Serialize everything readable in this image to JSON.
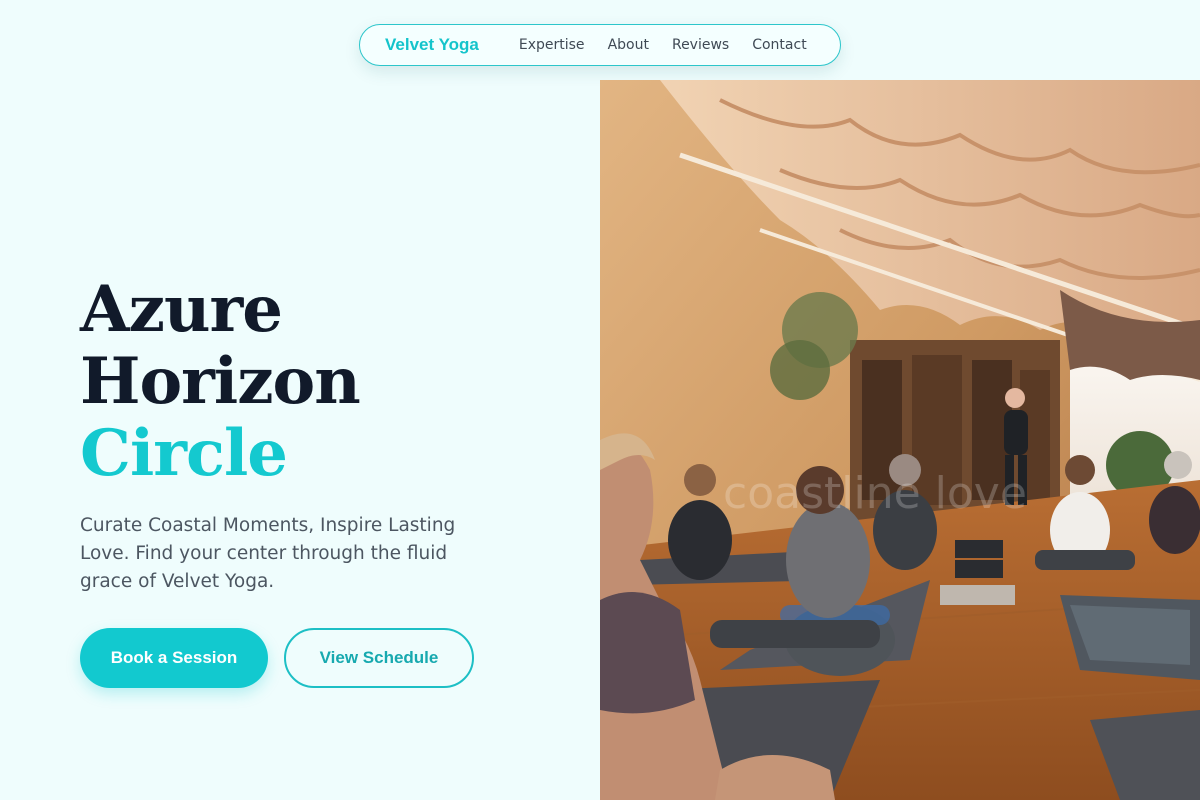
{
  "nav": {
    "brand": "Velvet Yoga",
    "links": [
      "Expertise",
      "About",
      "Reviews",
      "Contact"
    ]
  },
  "hero": {
    "title_line1": "Azure",
    "title_line2": "Horizon",
    "title_line3": "Circle",
    "subtitle": "Curate Coastal Moments, Inspire Lasting Love. Find your center through the fluid grace of Velvet Yoga.",
    "primary_button": "Book a Session",
    "secondary_button": "View Schedule"
  },
  "photo": {
    "watermark": "coastline love"
  },
  "colors": {
    "accent": "#14c9cf",
    "background": "#effdfd",
    "heading": "#111a2a"
  }
}
